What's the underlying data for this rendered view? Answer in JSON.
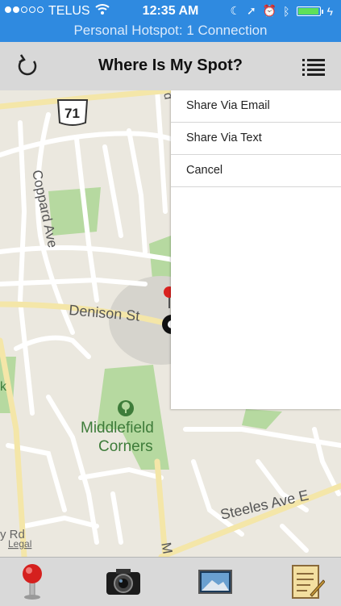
{
  "status_bar": {
    "carrier": "TELUS",
    "time": "12:35 AM",
    "hotspot": "Personal Hotspot: 1 Connection"
  },
  "nav": {
    "title": "Where Is My Spot?"
  },
  "menu": {
    "items": [
      {
        "label": "Share Via Email"
      },
      {
        "label": "Share Via Text"
      },
      {
        "label": "Cancel"
      }
    ]
  },
  "map": {
    "route_shield": "71",
    "labels": {
      "coppard": "Coppard Ave",
      "denison": "Denison St",
      "middlefield_1": "Middlefield",
      "middlefield_2": "Corners",
      "steeles": "Steeles Ave E",
      "rd": "y Rd",
      "legal": "Legal",
      "m_frag": "M",
      "k_frag": "k",
      "d_frag": "d"
    }
  },
  "colors": {
    "status_bg": "#2f8ae0",
    "park": "#b6d9a0",
    "road": "#ffffff",
    "major_road": "#f4e6a8"
  }
}
